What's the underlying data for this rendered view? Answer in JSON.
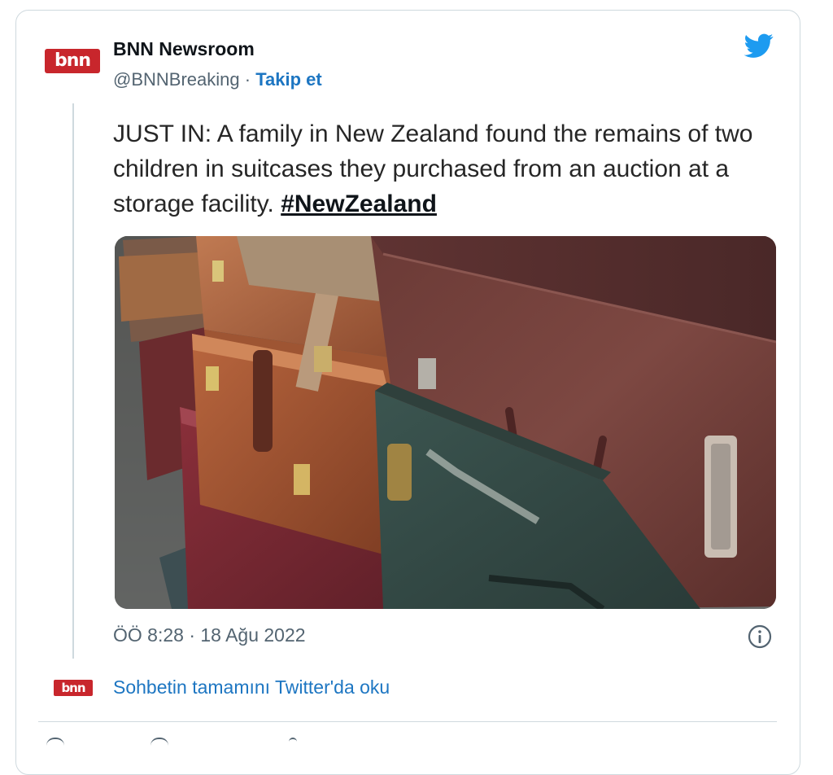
{
  "tweet": {
    "author": {
      "name": "BNN Newsroom",
      "handle": "@BNNBreaking",
      "separator": "·",
      "follow_label": "Takip et",
      "logo_text": "bnn",
      "avatar_color": "#c8262c"
    },
    "text": "JUST IN: A family in New Zealand found the remains of two children in suitcases they purchased from an auction at a storage facility.",
    "hashtag": "#NewZealand",
    "timestamp": "ÖÖ 8:28 · 18 Ağu 2022",
    "read_more_label": "Sohbetin tamamını Twitter'da oku",
    "brand_color": "#1d9bf0",
    "link_color": "#1d76c2",
    "icons": {
      "platform": "twitter-bird-icon",
      "info": "info-icon"
    }
  }
}
